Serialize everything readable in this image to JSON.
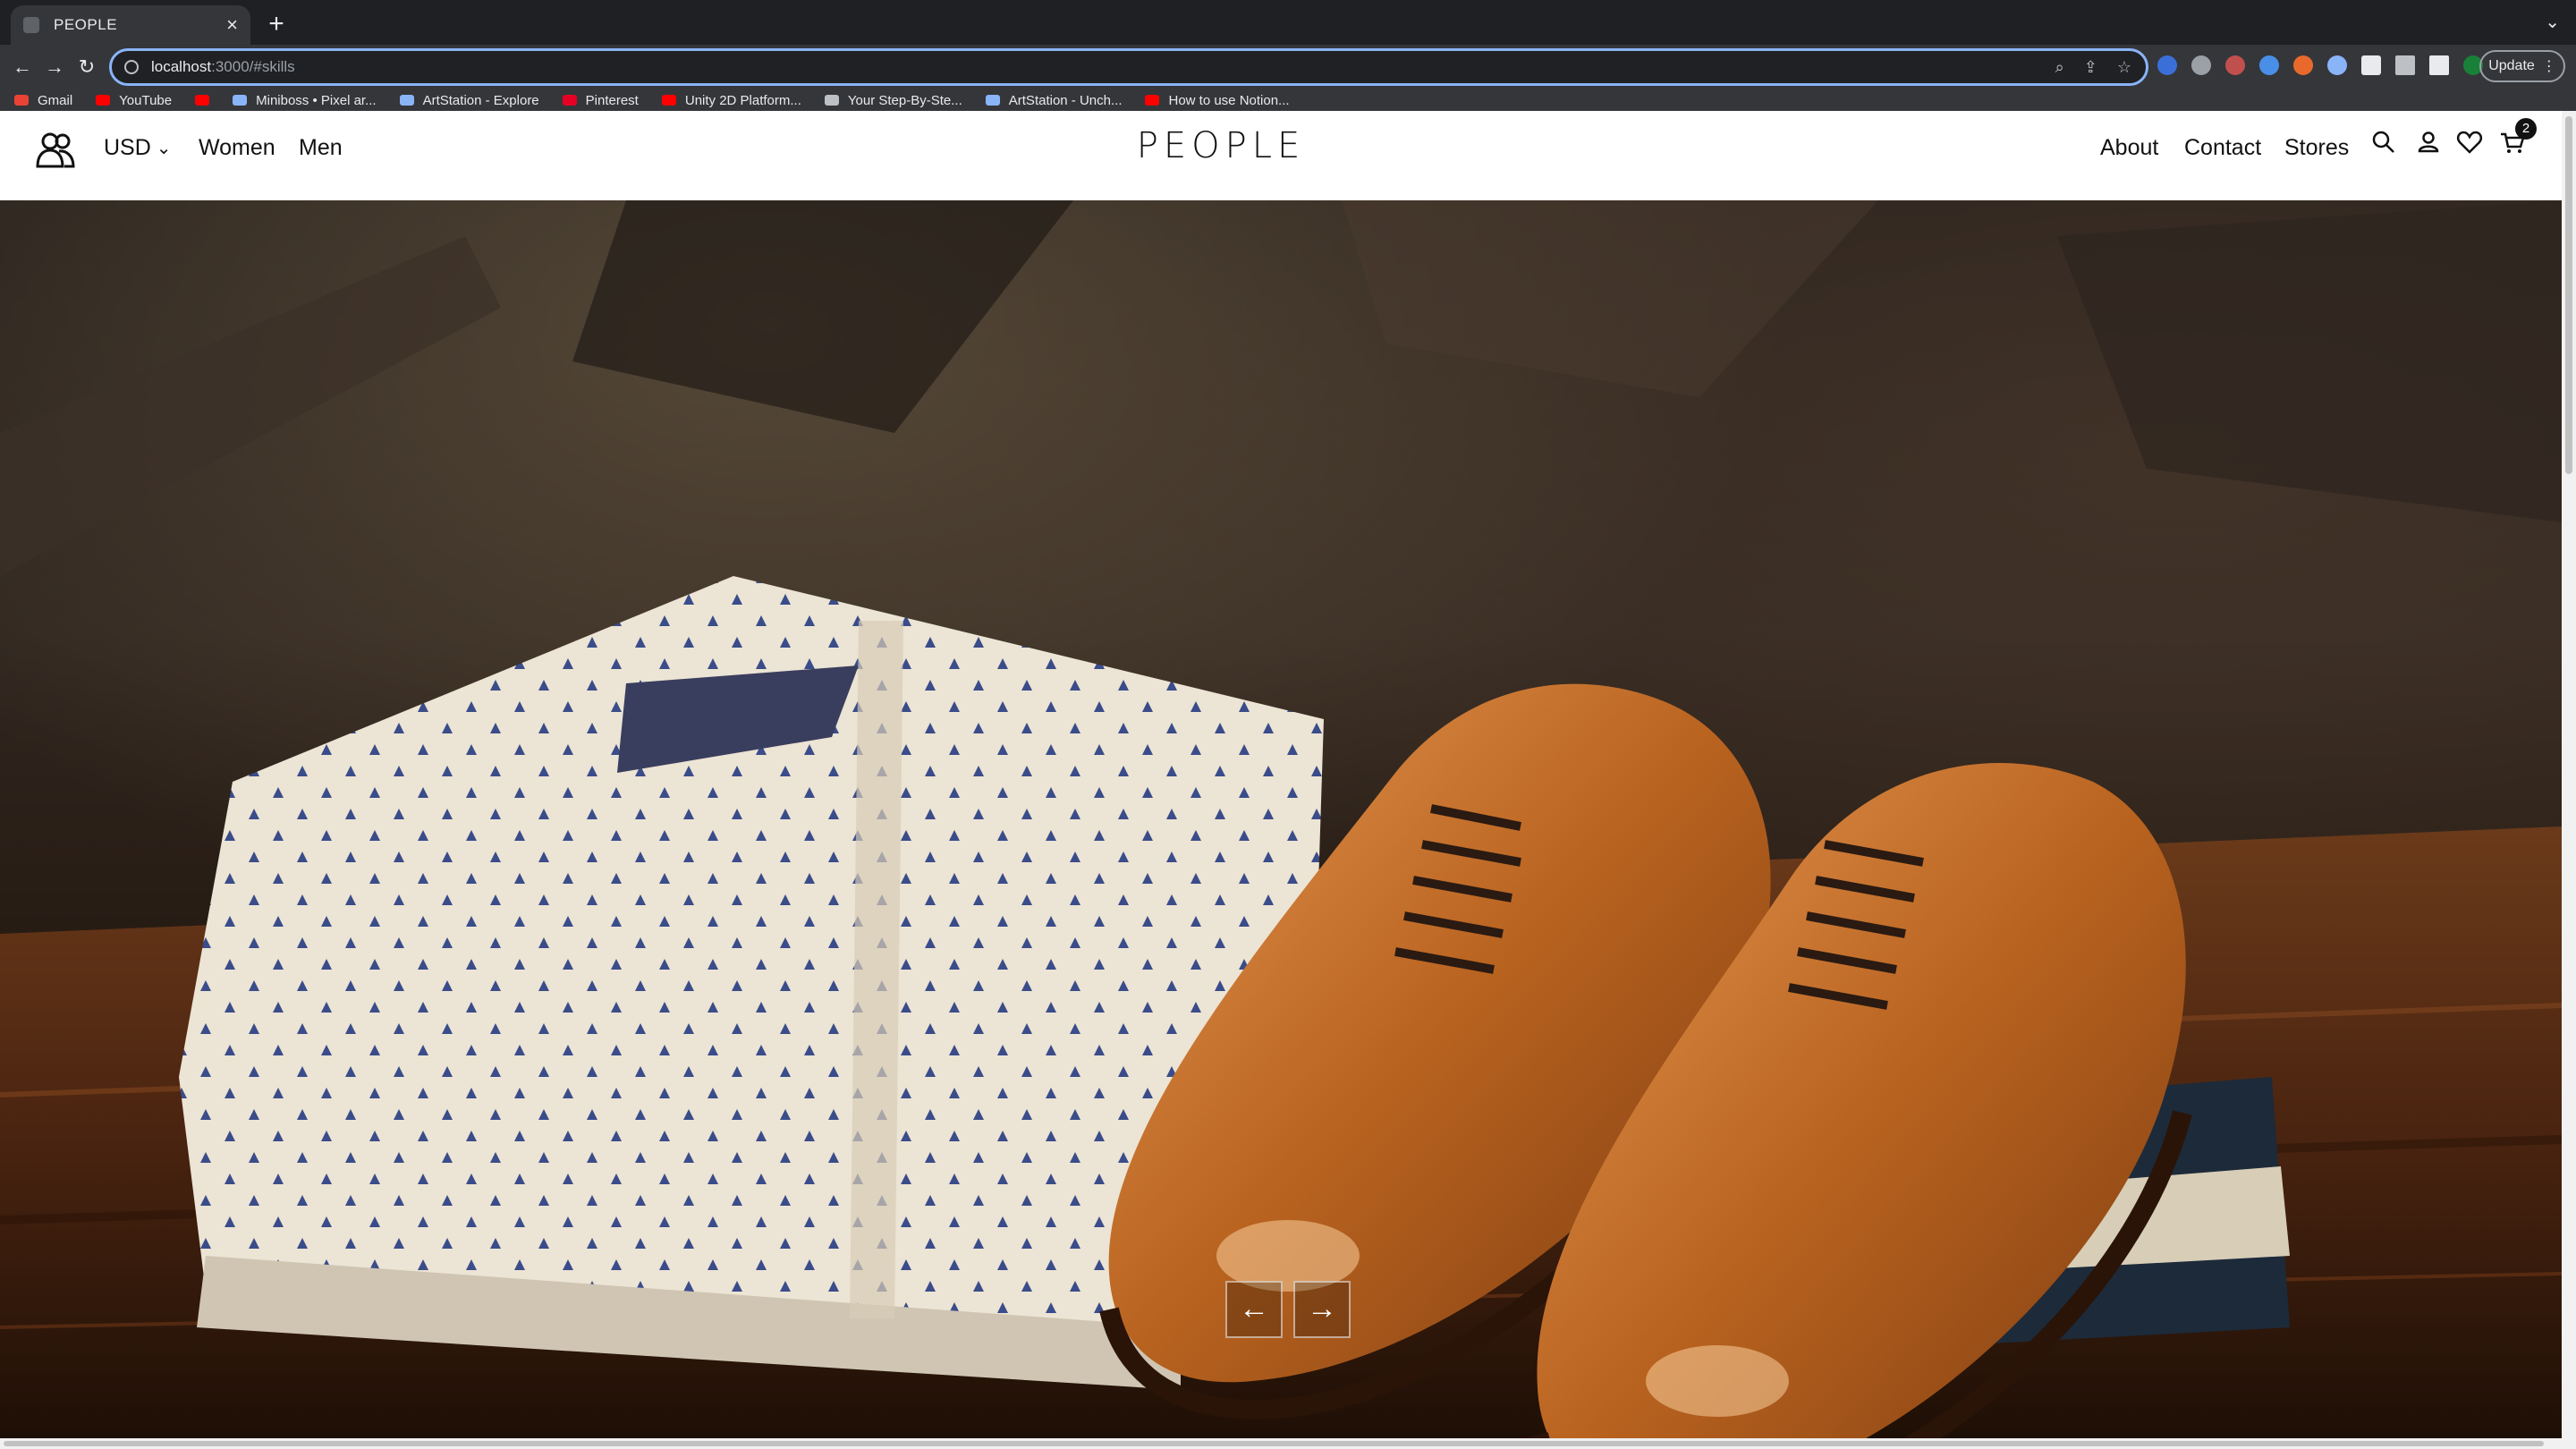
{
  "browser": {
    "tab_title": "PEOPLE",
    "url_host": "localhost",
    "url_path": ":3000/#skills",
    "update_label": "Update",
    "bookmarks": [
      {
        "label": "Gmail",
        "color": "#ea4335"
      },
      {
        "label": "YouTube",
        "color": "#ff0000"
      },
      {
        "label": "",
        "color": "#ff0000"
      },
      {
        "label": "Miniboss • Pixel ar...",
        "color": "#8ab4f8"
      },
      {
        "label": "ArtStation - Explore",
        "color": "#8ab4f8"
      },
      {
        "label": "Pinterest",
        "color": "#e60023"
      },
      {
        "label": "Unity 2D Platform...",
        "color": "#ff0000"
      },
      {
        "label": "Your Step-By-Ste...",
        "color": "#bdc1c6"
      },
      {
        "label": "ArtStation - Unch...",
        "color": "#8ab4f8"
      },
      {
        "label": "How to use Notion...",
        "color": "#ff0000"
      }
    ]
  },
  "site": {
    "currency": "USD",
    "nav_left": [
      "Women",
      "Men"
    ],
    "brand": "PEOPLE",
    "nav_right": [
      "About",
      "Contact",
      "Stores"
    ],
    "cart_count": "2"
  },
  "hero": {
    "prev_arrow": "←",
    "next_arrow": "→"
  }
}
